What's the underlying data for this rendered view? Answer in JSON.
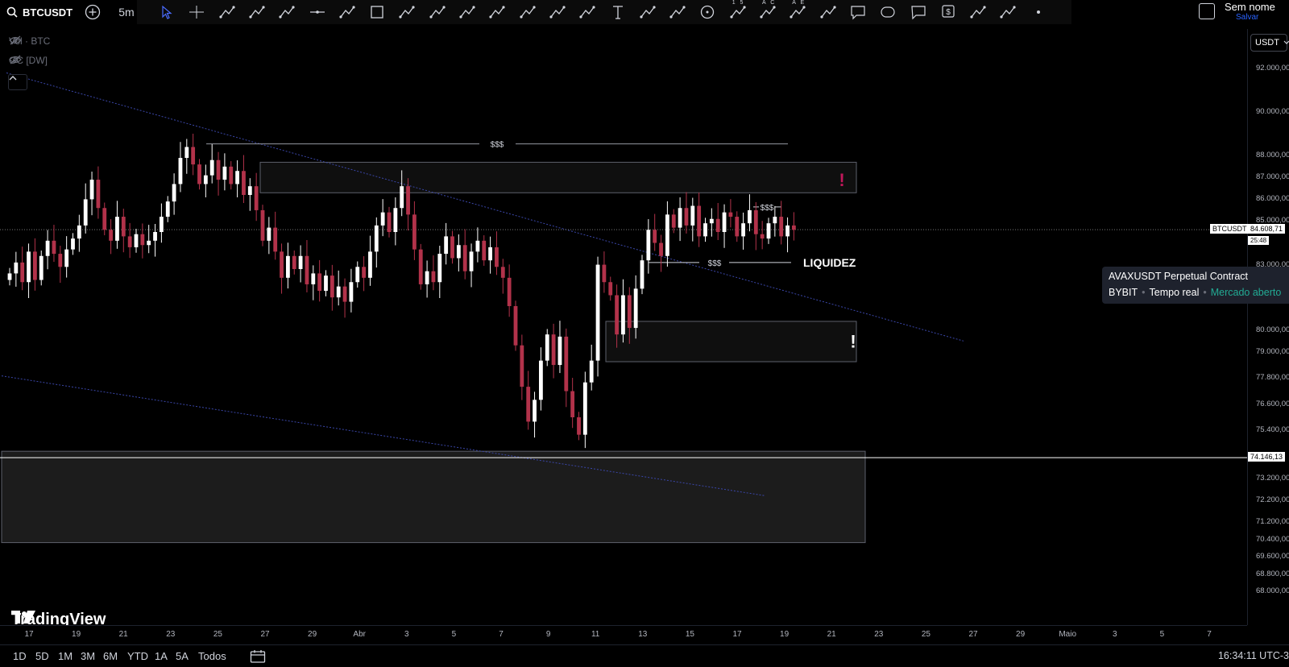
{
  "toolbar": {
    "symbol": "BTCUSDT",
    "interval": "5m",
    "layout_title": "Sem nome",
    "layout_subtitle": "Salvar",
    "draw_tools": [
      "cursor-icon",
      "crosshair-icon",
      "trendline-icon",
      "curve-icon",
      "ray-icon",
      "horizontal-line-icon",
      "path-icon",
      "rectangle-icon",
      "fib-icon",
      "parallel-channel-icon",
      "arc-icon",
      "polyline-icon",
      "pitchfork-icon",
      "gann-icon",
      "regression-icon",
      "text-icon",
      "brush-icon",
      "arrow-icon",
      "circle-icon",
      "xabcd-icon",
      "abcd-icon",
      "elliott-icon",
      "eraser-icon",
      "comment-icon",
      "callout-icon",
      "note-icon",
      "price-label-icon",
      "anchored-vwap-icon",
      "measure-icon",
      "more-icon"
    ],
    "elliott_tool_labels": [
      "1 5",
      "A C",
      "A E"
    ]
  },
  "legend": {
    "volume": "Vol · BTC",
    "indicator": "GC [DW]"
  },
  "currency": "USDT",
  "price_axis": [
    "92.000,00",
    "90.000,00",
    "88.000,00",
    "87.000,00",
    "86.000,00",
    "85.000,00",
    "83.000,00",
    "80.000,00",
    "79.000,00",
    "77.800,00",
    "76.600,00",
    "75.400,00",
    "73.200,00",
    "72.200,00",
    "71.200,00",
    "70.400,00",
    "69.600,00",
    "68.800,00",
    "68.000,00"
  ],
  "price_tags": {
    "symbol_tag": "BTCUSDT",
    "last_price": "84.608,71",
    "countdown": "25:48",
    "line_price": "74.146,13"
  },
  "time_axis": [
    "17",
    "19",
    "21",
    "23",
    "25",
    "27",
    "29",
    "Abr",
    "3",
    "5",
    "7",
    "9",
    "11",
    "13",
    "15",
    "17",
    "19",
    "21",
    "23",
    "25",
    "27",
    "29",
    "Maio",
    "3",
    "5",
    "7"
  ],
  "annotations": {
    "liquidity_top": "$$$",
    "liquidity_mid": "$$$",
    "liquidity_low": "$$$",
    "liquidez_label": "LIQUIDEZ",
    "alert_1": "!",
    "alert_2": "!"
  },
  "info_popup": {
    "title": "AVAXUSDT Perpetual Contract",
    "exchange": "BYBIT",
    "feed": "Tempo real",
    "status": "Mercado aberto"
  },
  "logo": "TradingView",
  "ranges": [
    "1D",
    "5D",
    "1M",
    "3M",
    "6M",
    "YTD",
    "1A",
    "5A",
    "Todos"
  ],
  "clock": "16:34:11 UTC-3",
  "colors": {
    "bull": "#ffffff",
    "bear": "#b2324a",
    "zone_fill": "#1c1c1c",
    "zone_border": "#5d606b",
    "channel": "#3a46a8",
    "accent": "#2962ff",
    "alert_red": "#c2185b"
  },
  "chart_data": {
    "type": "candlestick",
    "y_range": [
      67500,
      93000
    ],
    "price_levels": {
      "last": 84608.71,
      "marked_line": 74146.13
    },
    "series_close": [
      82600,
      83100,
      82200,
      83600,
      82300,
      83400,
      84100,
      83500,
      82900,
      83700,
      84200,
      84800,
      86000,
      86900,
      85600,
      84600,
      84100,
      85200,
      84300,
      83800,
      84400,
      83900,
      84100,
      84500,
      85200,
      85900,
      86700,
      87900,
      88400,
      87600,
      86700,
      87100,
      87800,
      86900,
      87500,
      86700,
      87300,
      86200,
      86600,
      85500,
      84100,
      84700,
      83600,
      82400,
      83400,
      82800,
      83400,
      82100,
      82600,
      81800,
      82500,
      81500,
      82000,
      81300,
      82200,
      82900,
      82400,
      83600,
      84800,
      85400,
      84500,
      85600,
      86600,
      85300,
      83700,
      82100,
      82700,
      82200,
      83500,
      84300,
      83300,
      83900,
      82700,
      83600,
      84100,
      83200,
      83800,
      82900,
      82400,
      81100,
      79300,
      77400,
      75800,
      76800,
      78600,
      79800,
      78400,
      79700,
      77200,
      76000,
      75200,
      77600,
      78600,
      83000,
      82200,
      81600,
      79800,
      81600,
      80100,
      81900,
      83200,
      84600,
      84000,
      83400,
      85300,
      84700,
      85600,
      84800,
      85700,
      84300,
      84900,
      85100,
      84500,
      85400,
      85200,
      84300,
      84900,
      85500,
      84400,
      84200,
      84900,
      85200,
      84300,
      84800,
      84600
    ]
  }
}
